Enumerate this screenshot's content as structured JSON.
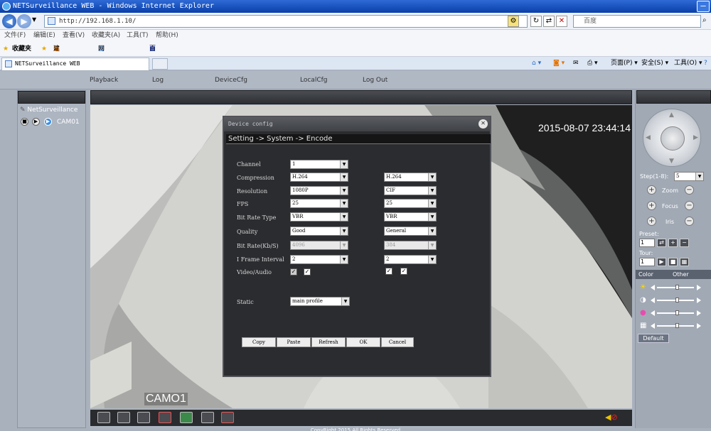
{
  "browser": {
    "title": "NETSurveillance WEB - Windows Internet Explorer",
    "address": "http://192.168.1.10/",
    "search_placeholder": "百度",
    "menu": [
      "文件(F)",
      "编辑(E)",
      "查看(V)",
      "收藏夹(A)",
      "工具(T)",
      "帮助(H)"
    ],
    "favorites": {
      "label": "收藏夹",
      "items": [
        "建议网站 ▾",
        "网页快讯库 ▾",
        "百度"
      ]
    },
    "tab_label": "NETSurveillance WEB",
    "command_bar": [
      "页面(P) ▾",
      "安全(S) ▾",
      "工具(O) ▾"
    ]
  },
  "app": {
    "nav": [
      "Playback",
      "Log",
      "DeviceCfg",
      "LocalCfg",
      "Log Out"
    ],
    "tree": {
      "root": "NetSurveillance",
      "camera": "CAM01"
    },
    "video": {
      "timestamp": "2015-08-07 23:44:14",
      "channel_label": "CAMO1"
    },
    "copyright": "CopyRight 2015 All Rights Reserved"
  },
  "dialog": {
    "title": "Device config",
    "breadcrumb": "Setting -> System -> Encode",
    "labels": {
      "channel": "Channel",
      "compression": "Compression",
      "resolution": "Resolution",
      "fps": "FPS",
      "bitrate_type": "Bit Rate Type",
      "quality": "Quality",
      "bitrate": "Bit Rate(Kb/S)",
      "iframe": "I Frame Interval",
      "video_audio": "Video/Audio",
      "static": "Static"
    },
    "main": {
      "channel": "1",
      "compression": "H.264",
      "resolution": "1080P",
      "fps": "25",
      "bitrate_type": "VBR",
      "quality": "Good",
      "bitrate": "4096",
      "iframe": "2",
      "static": "main profile"
    },
    "extra": {
      "compression": "H.264",
      "resolution": "CIF",
      "fps": "25",
      "bitrate_type": "VBR",
      "quality": "General",
      "bitrate": "384",
      "iframe": "2"
    },
    "buttons": {
      "copy": "Copy",
      "paste": "Paste",
      "refresh": "Refresh",
      "ok": "OK",
      "cancel": "Cancel"
    }
  },
  "right": {
    "step_label": "Step(1-8):",
    "step_value": "5",
    "zoom": "Zoom",
    "focus": "Focus",
    "iris": "Iris",
    "preset_label": "Preset:",
    "preset_value": "1",
    "tour_label": "Tour:",
    "tour_value": "1",
    "tab_color": "Color",
    "tab_other": "Other",
    "default_button": "Default",
    "sliders": {
      "brightness": 0.5,
      "contrast": 0.5,
      "saturation": 0.5,
      "hue": 0.5
    }
  }
}
